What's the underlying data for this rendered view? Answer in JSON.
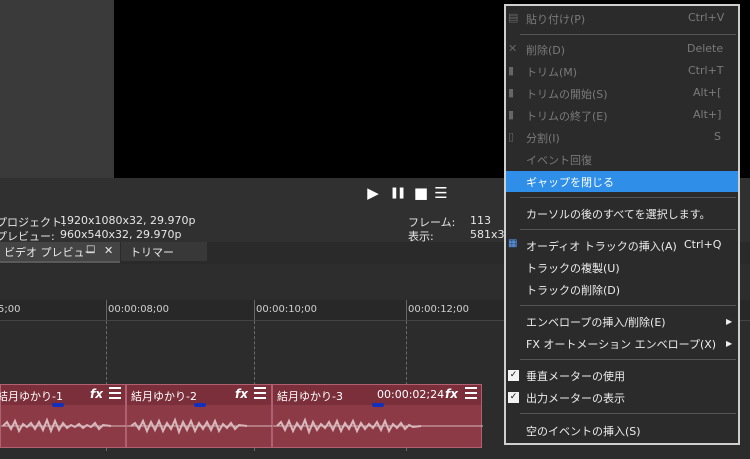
{
  "controls": {
    "play": "▶",
    "pause": "❚❚",
    "stop": "■",
    "more": "☰"
  },
  "info": {
    "project_label": "プロジェクト:",
    "project_value": "1920x1080x32, 29.970p",
    "preview_label": "プレビュー:",
    "preview_value": "960x540x32, 29.970p",
    "frame_label": "フレーム:",
    "frame_value": "113",
    "display_label": "表示:",
    "display_value": "581x3"
  },
  "tabs": {
    "video_preview": "ビデオ プレビュー",
    "trimmer": "トリマー",
    "restore_icon": "□",
    "close_icon": "✕"
  },
  "ruler": {
    "labels": [
      "5;00",
      "00:00:08;00",
      "00:00:10;00",
      "00:00:12;00"
    ]
  },
  "clips": [
    {
      "title": "結月ゆかり-1",
      "fx": "fx"
    },
    {
      "title": "結月ゆかり-2",
      "fx": "fx"
    },
    {
      "title": "結月ゆかり-3",
      "fx": "fx",
      "time": "00:00:02;24"
    }
  ],
  "menu": {
    "paste": {
      "label": "貼り付け(P)",
      "shortcut": "Ctrl+V"
    },
    "delete": {
      "label": "削除(D)",
      "shortcut": "Delete"
    },
    "trim": {
      "label": "トリム(M)",
      "shortcut": "Ctrl+T"
    },
    "trim_start": {
      "label": "トリムの開始(S)",
      "shortcut": "Alt+["
    },
    "trim_end": {
      "label": "トリムの終了(E)",
      "shortcut": "Alt+]"
    },
    "split": {
      "label": "分割(I)",
      "shortcut": "S"
    },
    "restore_event": {
      "label": "イベント回復"
    },
    "close_gap": {
      "label": "ギャップを閉じる"
    },
    "select_after_cursor": {
      "label": "カーソルの後のすべてを選択します。"
    },
    "insert_audio_track": {
      "label": "オーディオ トラックの挿入(A)",
      "shortcut": "Ctrl+Q"
    },
    "duplicate_track": {
      "label": "トラックの複製(U)"
    },
    "delete_track": {
      "label": "トラックの削除(D)"
    },
    "insert_remove_envelope": {
      "label": "エンベロープの挿入/削除(E)"
    },
    "fx_automation_envelope": {
      "label": "FX オートメーション エンベロープ(X)"
    },
    "use_vertical_meter": {
      "label": "垂直メーターの使用"
    },
    "show_output_meter": {
      "label": "出力メーターの表示"
    },
    "insert_empty_event": {
      "label": "空のイベントの挿入(S)"
    }
  },
  "colors": {
    "highlight": "#2e8ee8",
    "clip": "#8c3a45",
    "preview_value": "#e9a0a0"
  }
}
